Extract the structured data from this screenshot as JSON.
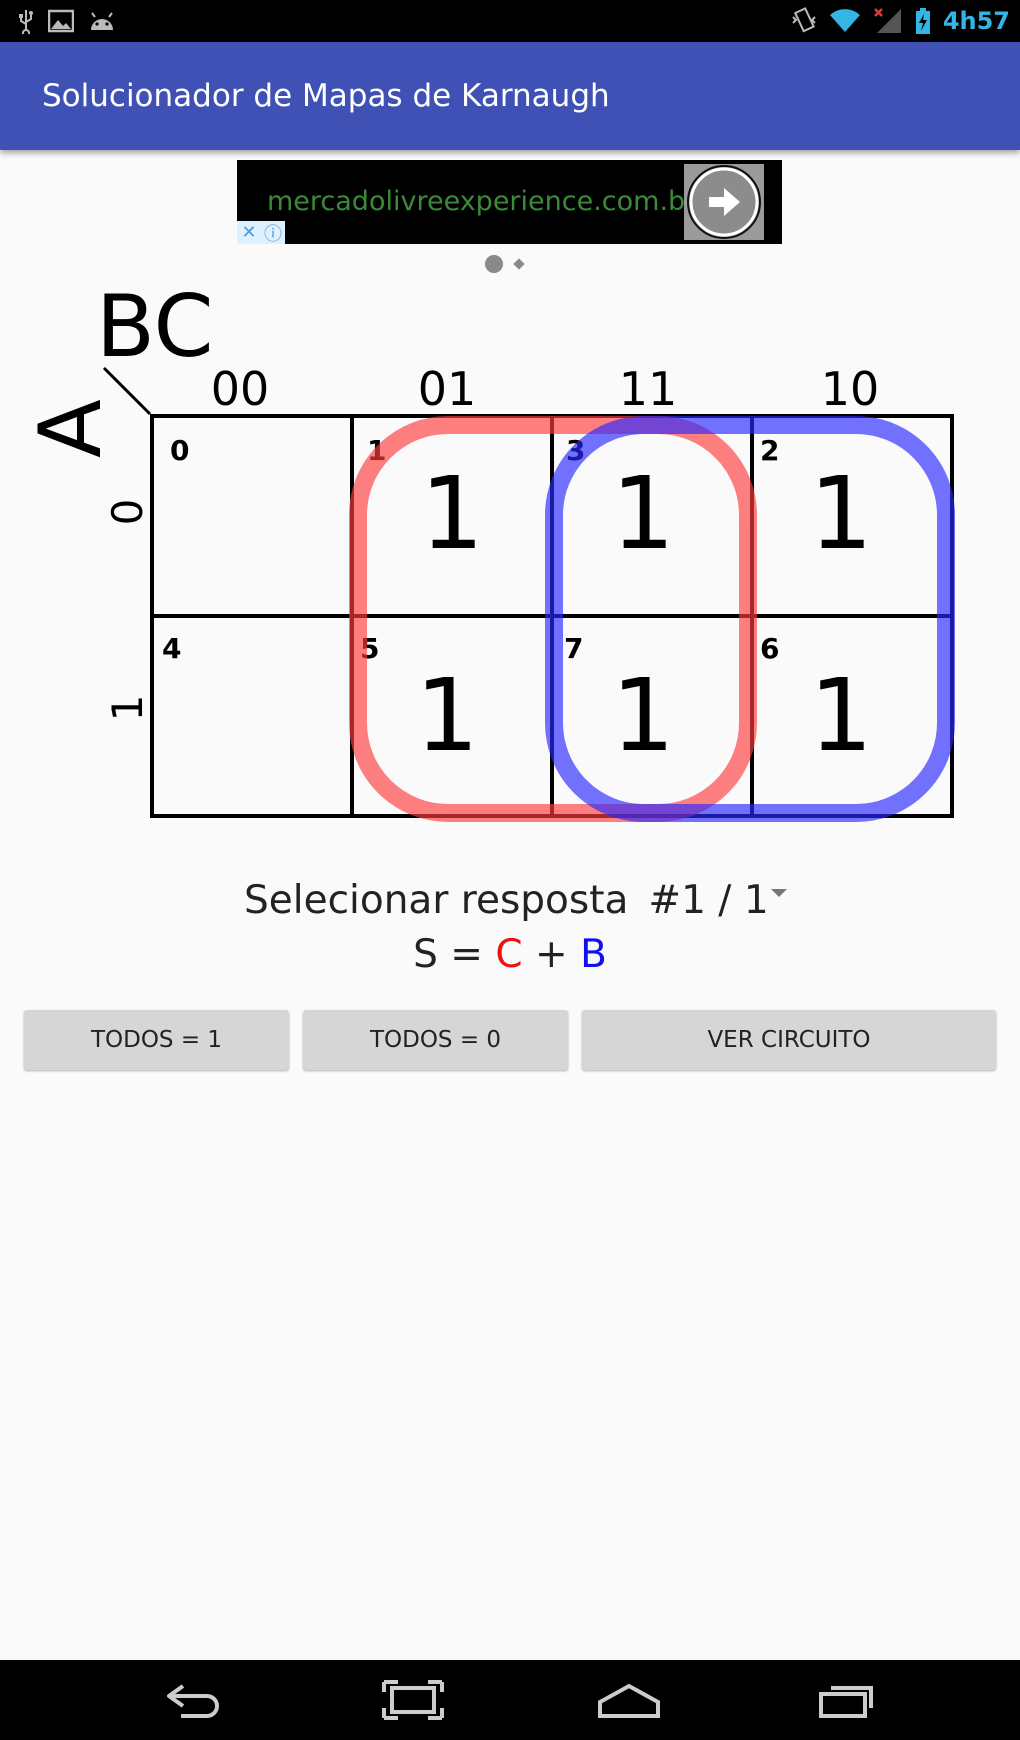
{
  "status_bar": {
    "time": "4h57",
    "icons_left": [
      "usb-icon",
      "image-icon",
      "android-icon"
    ],
    "icons_right": [
      "vibrate-icon",
      "wifi-icon",
      "signal-icon",
      "battery-icon"
    ],
    "accent_color": "#33b5e5"
  },
  "app_bar": {
    "title": "Solucionador de Mapas de Karnaugh",
    "color": "#3f51b5"
  },
  "ad": {
    "url_text": "mercadolivreexperience.com.b...",
    "close_glyph": "✕",
    "info_glyph": "ⓘ",
    "arrow_icon": "arrow-right-icon"
  },
  "kmap": {
    "row_var": "A",
    "col_var": "BC",
    "col_labels": [
      "00",
      "01",
      "11",
      "10"
    ],
    "row_labels": [
      "0",
      "1"
    ],
    "cells": [
      [
        {
          "index": "0",
          "value": ""
        },
        {
          "index": "1",
          "value": "1"
        },
        {
          "index": "3",
          "value": "1"
        },
        {
          "index": "2",
          "value": "1"
        }
      ],
      [
        {
          "index": "4",
          "value": ""
        },
        {
          "index": "5",
          "value": "1"
        },
        {
          "index": "7",
          "value": "1"
        },
        {
          "index": "6",
          "value": "1"
        }
      ]
    ],
    "groups": [
      {
        "term": "C",
        "cells": [
          "1",
          "3",
          "5",
          "7"
        ],
        "color": "#ff5a5a"
      },
      {
        "term": "B",
        "cells": [
          "3",
          "2",
          "7",
          "6"
        ],
        "color": "#4a4aff"
      }
    ]
  },
  "answer": {
    "select_label": "Selecionar resposta",
    "select_value": "#1 / 1",
    "expr_prefix": "S = ",
    "term1": "C",
    "plus": " + ",
    "term2": "B",
    "term1_color": "#ee1111",
    "term2_color": "#1111ee"
  },
  "buttons": {
    "all_one": "TODOS = 1",
    "all_zero": "TODOS = 0",
    "circuit": "VER CIRCUITO"
  },
  "nav_bar": {
    "icons": [
      "back-icon",
      "home-icon",
      "recents-icon",
      "screenshot-icon"
    ]
  }
}
